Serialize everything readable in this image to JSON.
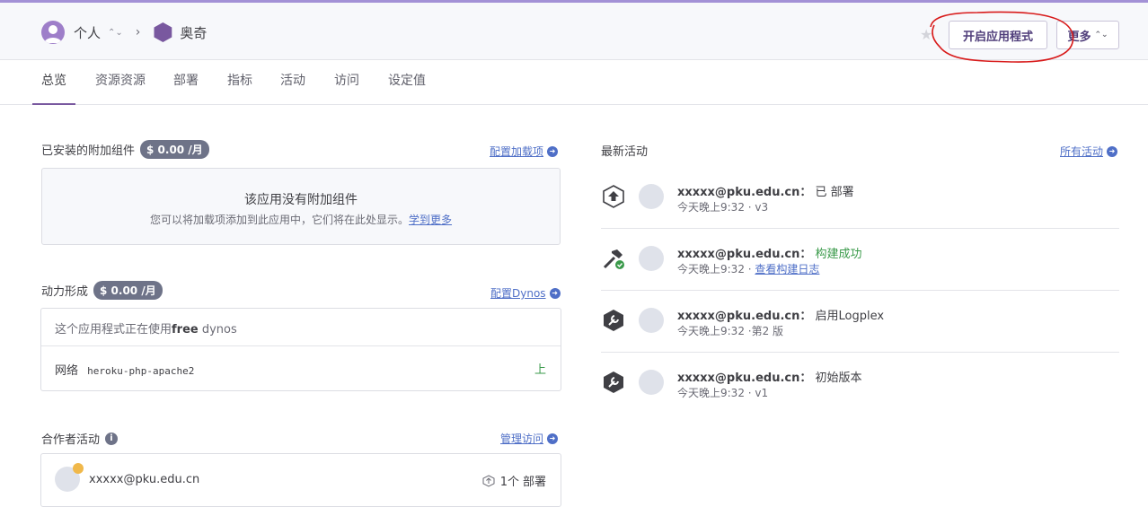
{
  "header": {
    "account_label": "个人",
    "app_name": "奥奇",
    "open_app_button": "开启应用程式",
    "more_button": "更多"
  },
  "tabs": [
    "总览",
    "资源资源",
    "部署",
    "指标",
    "活动",
    "访问",
    "设定值"
  ],
  "addons": {
    "title": "已安装的附加组件",
    "price": "$ 0.00 /月",
    "config_link": "配置加载项",
    "empty_title": "该应用没有附加组件",
    "empty_desc": "您可以将加载项添加到此应用中，它们将在此处显示。",
    "learn_more": "学到更多"
  },
  "dynos": {
    "title": "动力形成",
    "price": "$ 0.00 /月",
    "config_link": "配置Dynos",
    "usage_prefix": "这个应用程式正在使用",
    "usage_bold": "free",
    "usage_suffix": " dynos",
    "dyno_type": "网络",
    "dyno_command": "heroku-php-apache2",
    "dyno_state": "上"
  },
  "collaborators": {
    "title": "合作者活动",
    "manage_link": "管理访问",
    "email": "xxxxx@pku.edu.cn",
    "count": "1个",
    "count_label": "部署"
  },
  "activity": {
    "title": "最新活动",
    "all_link": "所有活动",
    "items": [
      {
        "user": "xxxxx@pku.edu.cn：",
        "action": "已 部署",
        "time": "今天晚上9:32",
        "detail": "· v3",
        "icon": "deploy-icon"
      },
      {
        "user": "xxxxx@pku.edu.cn：",
        "action": "构建成功",
        "time": "今天晚上9:32 ·",
        "detail": "查看构建日志",
        "icon": "build-icon"
      },
      {
        "user": "xxxxx@pku.edu.cn：",
        "action": "启用Logplex",
        "time": "今天晚上9:32",
        "detail": "·第2 版",
        "icon": "wrench-icon"
      },
      {
        "user": "xxxxx@pku.edu.cn：",
        "action": "初始版本",
        "time": "今天晚上9:32",
        "detail": "· v1",
        "icon": "wrench-icon"
      }
    ]
  },
  "colors": {
    "accent": "#79589f",
    "link": "#4f6fc7",
    "success": "#3a9a4a",
    "annotation": "#d81b1b"
  }
}
